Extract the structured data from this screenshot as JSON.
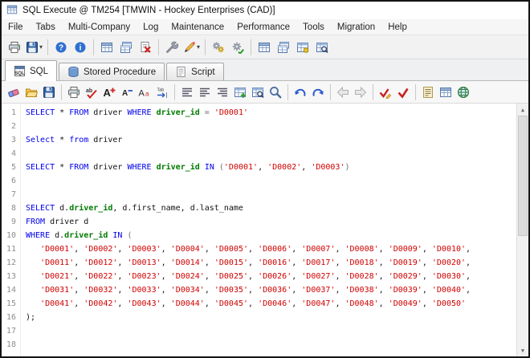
{
  "window": {
    "title": "SQL Execute @ TM254 [TMWIN - Hockey Enterprises (CAD)]"
  },
  "menu": {
    "items": [
      "File",
      "Tabs",
      "Multi-Company",
      "Log",
      "Maintenance",
      "Performance",
      "Tools",
      "Migration",
      "Help"
    ]
  },
  "ui": {
    "dropdown_glyph": "▾"
  },
  "scrollbar": {
    "up": "▲",
    "down": "▼"
  },
  "colors": {
    "keyword": "#0000EE",
    "column_identifier": "#007A00",
    "string_literal": "#D00000",
    "operator": "#707070"
  },
  "toolbar_main": {
    "items": [
      {
        "name": "print-button",
        "icon": "printer"
      },
      {
        "name": "export-dropdown-button",
        "icon": "disk",
        "dropdown": true
      },
      {
        "type": "sep"
      },
      {
        "name": "help-button",
        "icon": "help"
      },
      {
        "name": "info-button",
        "icon": "info"
      },
      {
        "type": "sep"
      },
      {
        "name": "table-query-button",
        "icon": "table"
      },
      {
        "name": "table-list-button",
        "icon": "tables"
      },
      {
        "name": "delete-script-button",
        "icon": "doc-x"
      },
      {
        "type": "sep"
      },
      {
        "name": "tools-button",
        "icon": "wrench"
      },
      {
        "name": "edit-dropdown-button",
        "icon": "pencil",
        "dropdown": true
      },
      {
        "type": "sep"
      },
      {
        "name": "settings-button",
        "icon": "gears"
      },
      {
        "name": "process-button",
        "icon": "gear-run"
      },
      {
        "type": "sep"
      },
      {
        "name": "db-tables-button",
        "icon": "table"
      },
      {
        "name": "db-structure-button",
        "icon": "tables"
      },
      {
        "name": "db-index-button",
        "icon": "table-key"
      },
      {
        "name": "db-browse-button",
        "icon": "table-search"
      }
    ]
  },
  "tabs": [
    {
      "name": "tab-sql",
      "label": "SQL",
      "icon": "sql",
      "active": true
    },
    {
      "name": "tab-stored-procedure",
      "label": "Stored Procedure",
      "icon": "stored-procedure",
      "active": false
    },
    {
      "name": "tab-script",
      "label": "Script",
      "icon": "script",
      "active": false
    }
  ],
  "toolbar_editor": {
    "items": [
      {
        "name": "clear-editor-button",
        "icon": "eraser"
      },
      {
        "name": "open-file-button",
        "icon": "folder"
      },
      {
        "name": "save-file-button",
        "icon": "disk"
      },
      {
        "type": "sep"
      },
      {
        "name": "print-sql-button",
        "icon": "printer"
      },
      {
        "name": "spell-check-button",
        "icon": "abc"
      },
      {
        "name": "font-increase-button",
        "icon": "font-plus"
      },
      {
        "name": "font-decrease-button",
        "icon": "font-minus"
      },
      {
        "name": "font-select-button",
        "icon": "font-aa"
      },
      {
        "name": "indent-button",
        "icon": "tab"
      },
      {
        "type": "sep"
      },
      {
        "name": "format-sql-button",
        "icon": "align"
      },
      {
        "name": "comment-lines-button",
        "icon": "align-left"
      },
      {
        "name": "uppercase-keywords-button",
        "icon": "align-right"
      },
      {
        "name": "insert-table-button",
        "icon": "table-plus"
      },
      {
        "name": "find-table-button",
        "icon": "table-search"
      },
      {
        "name": "find-button",
        "icon": "magnifier"
      },
      {
        "type": "sep"
      },
      {
        "name": "undo-button",
        "icon": "undo"
      },
      {
        "name": "redo-button",
        "icon": "redo"
      },
      {
        "type": "sep"
      },
      {
        "name": "previous-sql-button",
        "icon": "arrow-left"
      },
      {
        "name": "next-sql-button",
        "icon": "arrow-right"
      },
      {
        "type": "sep"
      },
      {
        "name": "validate-sql-button",
        "icon": "check-pencil"
      },
      {
        "name": "execute-sql-button",
        "icon": "check-red"
      },
      {
        "type": "sep"
      },
      {
        "name": "history-button",
        "icon": "scroll"
      },
      {
        "name": "results-grid-button",
        "icon": "table"
      },
      {
        "name": "web-help-button",
        "icon": "globe"
      }
    ]
  },
  "editor": {
    "lines": [
      {
        "n": 1,
        "t": [
          [
            "kw",
            "SELECT"
          ],
          [
            "pl",
            " * "
          ],
          [
            "kw",
            "FROM"
          ],
          [
            "pl",
            " driver "
          ],
          [
            "kw",
            "WHERE"
          ],
          [
            "pl",
            " "
          ],
          [
            "col",
            "driver_id"
          ],
          [
            "op",
            " = "
          ],
          [
            "str",
            "'D0001'"
          ]
        ]
      },
      {
        "n": 2,
        "t": []
      },
      {
        "n": 3,
        "t": [
          [
            "kw",
            "Select"
          ],
          [
            "pl",
            " * "
          ],
          [
            "kw",
            "from"
          ],
          [
            "pl",
            " driver"
          ]
        ]
      },
      {
        "n": 4,
        "t": []
      },
      {
        "n": 5,
        "t": [
          [
            "kw",
            "SELECT"
          ],
          [
            "pl",
            " * "
          ],
          [
            "kw",
            "FROM"
          ],
          [
            "pl",
            " driver "
          ],
          [
            "kw",
            "WHERE"
          ],
          [
            "pl",
            " "
          ],
          [
            "col",
            "driver_id"
          ],
          [
            "pl",
            " "
          ],
          [
            "kw",
            "IN"
          ],
          [
            "op",
            " ("
          ],
          [
            "str",
            "'D0001'"
          ],
          [
            "pl",
            ", "
          ],
          [
            "str",
            "'D0002'"
          ],
          [
            "pl",
            ", "
          ],
          [
            "str",
            "'D0003'"
          ],
          [
            "op",
            ")"
          ]
        ]
      },
      {
        "n": 6,
        "t": []
      },
      {
        "n": 7,
        "t": []
      },
      {
        "n": 8,
        "t": [
          [
            "kw",
            "SELECT"
          ],
          [
            "pl",
            " d."
          ],
          [
            "col",
            "driver_id"
          ],
          [
            "pl",
            ", d.first_name, d.last_name"
          ]
        ]
      },
      {
        "n": 9,
        "t": [
          [
            "kw",
            "FROM"
          ],
          [
            "pl",
            " driver d"
          ]
        ]
      },
      {
        "n": 10,
        "t": [
          [
            "kw",
            "WHERE"
          ],
          [
            "pl",
            " d."
          ],
          [
            "col",
            "driver_id"
          ],
          [
            "pl",
            " "
          ],
          [
            "kw",
            "IN"
          ],
          [
            "op",
            " ("
          ]
        ]
      },
      {
        "n": 11,
        "t": [
          [
            "pl",
            "   "
          ],
          [
            "str",
            "'D0001'"
          ],
          [
            "pl",
            ", "
          ],
          [
            "str",
            "'D0002'"
          ],
          [
            "pl",
            ", "
          ],
          [
            "str",
            "'D0003'"
          ],
          [
            "pl",
            ", "
          ],
          [
            "str",
            "'D0004'"
          ],
          [
            "pl",
            ", "
          ],
          [
            "str",
            "'D0005'"
          ],
          [
            "pl",
            ", "
          ],
          [
            "str",
            "'D0006'"
          ],
          [
            "pl",
            ", "
          ],
          [
            "str",
            "'D0007'"
          ],
          [
            "pl",
            ", "
          ],
          [
            "str",
            "'D0008'"
          ],
          [
            "pl",
            ", "
          ],
          [
            "str",
            "'D0009'"
          ],
          [
            "pl",
            ", "
          ],
          [
            "str",
            "'D0010'"
          ],
          [
            "pl",
            ","
          ]
        ]
      },
      {
        "n": 12,
        "t": [
          [
            "pl",
            "   "
          ],
          [
            "str",
            "'D0011'"
          ],
          [
            "pl",
            ", "
          ],
          [
            "str",
            "'D0012'"
          ],
          [
            "pl",
            ", "
          ],
          [
            "str",
            "'D0013'"
          ],
          [
            "pl",
            ", "
          ],
          [
            "str",
            "'D0014'"
          ],
          [
            "pl",
            ", "
          ],
          [
            "str",
            "'D0015'"
          ],
          [
            "pl",
            ", "
          ],
          [
            "str",
            "'D0016'"
          ],
          [
            "pl",
            ", "
          ],
          [
            "str",
            "'D0017'"
          ],
          [
            "pl",
            ", "
          ],
          [
            "str",
            "'D0018'"
          ],
          [
            "pl",
            ", "
          ],
          [
            "str",
            "'D0019'"
          ],
          [
            "pl",
            ", "
          ],
          [
            "str",
            "'D0020'"
          ],
          [
            "pl",
            ","
          ]
        ]
      },
      {
        "n": 13,
        "t": [
          [
            "pl",
            "   "
          ],
          [
            "str",
            "'D0021'"
          ],
          [
            "pl",
            ", "
          ],
          [
            "str",
            "'D0022'"
          ],
          [
            "pl",
            ", "
          ],
          [
            "str",
            "'D0023'"
          ],
          [
            "pl",
            ", "
          ],
          [
            "str",
            "'D0024'"
          ],
          [
            "pl",
            ", "
          ],
          [
            "str",
            "'D0025'"
          ],
          [
            "pl",
            ", "
          ],
          [
            "str",
            "'D0026'"
          ],
          [
            "pl",
            ", "
          ],
          [
            "str",
            "'D0027'"
          ],
          [
            "pl",
            ", "
          ],
          [
            "str",
            "'D0028'"
          ],
          [
            "pl",
            ", "
          ],
          [
            "str",
            "'D0029'"
          ],
          [
            "pl",
            ", "
          ],
          [
            "str",
            "'D0030'"
          ],
          [
            "pl",
            ","
          ]
        ]
      },
      {
        "n": 14,
        "t": [
          [
            "pl",
            "   "
          ],
          [
            "str",
            "'D0031'"
          ],
          [
            "pl",
            ", "
          ],
          [
            "str",
            "'D0032'"
          ],
          [
            "pl",
            ", "
          ],
          [
            "str",
            "'D0033'"
          ],
          [
            "pl",
            ", "
          ],
          [
            "str",
            "'D0034'"
          ],
          [
            "pl",
            ", "
          ],
          [
            "str",
            "'D0035'"
          ],
          [
            "pl",
            ", "
          ],
          [
            "str",
            "'D0036'"
          ],
          [
            "pl",
            ", "
          ],
          [
            "str",
            "'D0037'"
          ],
          [
            "pl",
            ", "
          ],
          [
            "str",
            "'D0038'"
          ],
          [
            "pl",
            ", "
          ],
          [
            "str",
            "'D0039'"
          ],
          [
            "pl",
            ", "
          ],
          [
            "str",
            "'D0040'"
          ],
          [
            "pl",
            ","
          ]
        ]
      },
      {
        "n": 15,
        "t": [
          [
            "pl",
            "   "
          ],
          [
            "str",
            "'D0041'"
          ],
          [
            "pl",
            ", "
          ],
          [
            "str",
            "'D0042'"
          ],
          [
            "pl",
            ", "
          ],
          [
            "str",
            "'D0043'"
          ],
          [
            "pl",
            ", "
          ],
          [
            "str",
            "'D0044'"
          ],
          [
            "pl",
            ", "
          ],
          [
            "str",
            "'D0045'"
          ],
          [
            "pl",
            ", "
          ],
          [
            "str",
            "'D0046'"
          ],
          [
            "pl",
            ", "
          ],
          [
            "str",
            "'D0047'"
          ],
          [
            "pl",
            ", "
          ],
          [
            "str",
            "'D0048'"
          ],
          [
            "pl",
            ", "
          ],
          [
            "str",
            "'D0049'"
          ],
          [
            "pl",
            ", "
          ],
          [
            "str",
            "'D0050'"
          ]
        ]
      },
      {
        "n": 16,
        "t": [
          [
            "pl",
            ");"
          ]
        ]
      },
      {
        "n": 17,
        "t": []
      },
      {
        "n": 18,
        "t": []
      }
    ]
  }
}
